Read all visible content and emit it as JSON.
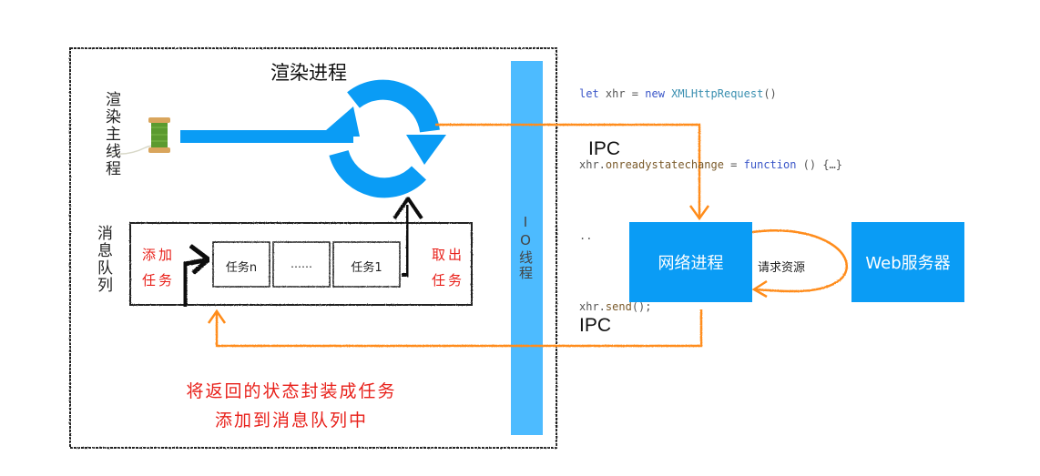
{
  "colors": {
    "blue": "#0a9cf5",
    "io_bar": "#4dbbff",
    "orange": "#ff8c1a",
    "red_text": "#e8201a",
    "frame": "#222222"
  },
  "render_process": {
    "title": "渲染进程",
    "main_thread_label": "渲染主线程",
    "message_queue_label": "消息队列",
    "add_task_label": [
      "添加",
      "任务"
    ],
    "take_task_label": [
      "取出",
      "任务"
    ],
    "queue_tasks": [
      "任务n",
      "……",
      "任务1"
    ],
    "io_thread_label": "IO线程",
    "caption_lines": [
      "将返回的状态封装成任务",
      "添加到消息队列中"
    ]
  },
  "code_snippet": {
    "lines": [
      [
        {
          "t": "let ",
          "c": "kw"
        },
        {
          "t": "xhr = ",
          "c": ""
        },
        {
          "t": "new ",
          "c": "kw"
        },
        {
          "t": "XMLHttpRequest",
          "c": "cls"
        },
        {
          "t": "()",
          "c": ""
        }
      ],
      [
        {
          "t": "xhr.",
          "c": ""
        },
        {
          "t": "onreadystatechange",
          "c": "prop"
        },
        {
          "t": " = ",
          "c": ""
        },
        {
          "t": "function",
          "c": "kw"
        },
        {
          "t": " () {…}",
          "c": ""
        }
      ],
      [
        {
          "t": "..",
          "c": ""
        }
      ],
      [
        {
          "t": "xhr.",
          "c": ""
        },
        {
          "t": "send",
          "c": "prop"
        },
        {
          "t": "();",
          "c": ""
        }
      ]
    ]
  },
  "ipc_labels": [
    "IPC",
    "IPC"
  ],
  "network_process": {
    "label": "网络进程"
  },
  "request_label": "请求资源",
  "web_server": {
    "label": "Web服务器"
  },
  "icons": {
    "spool": "thread-spool-icon",
    "cycle": "refresh-cycle-icon"
  }
}
